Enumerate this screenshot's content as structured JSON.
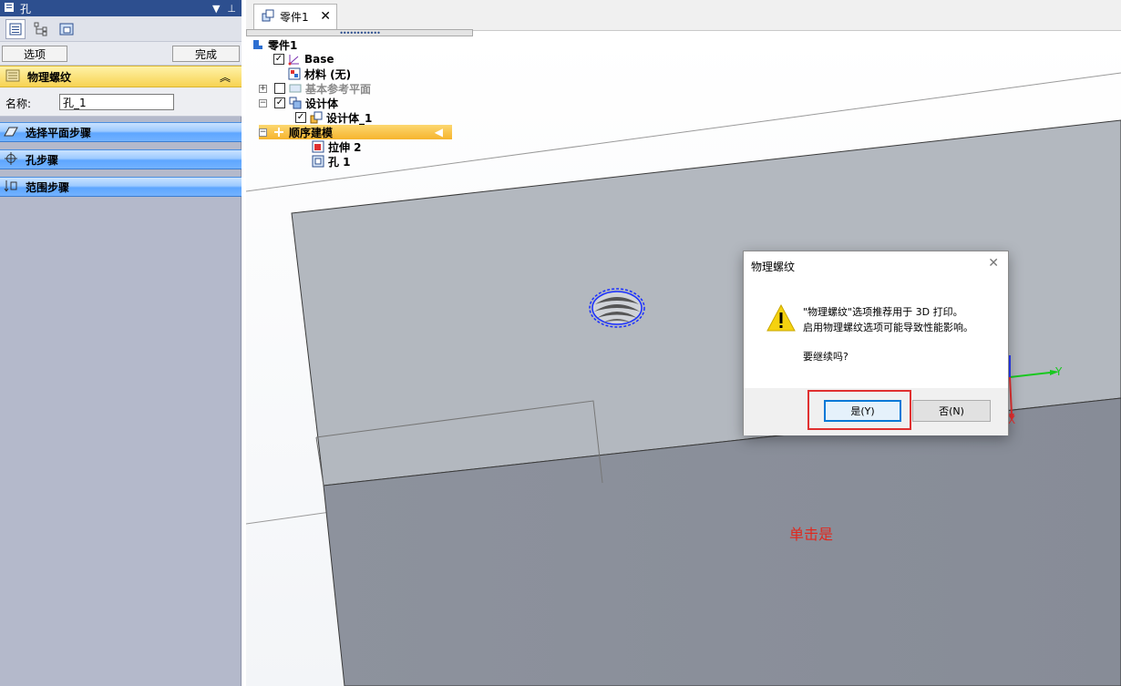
{
  "panel": {
    "title": "孔",
    "tabs": [
      "properties-icon",
      "tree-icon",
      "feature-icon"
    ],
    "options_button": "选项",
    "finish_button": "完成",
    "section_title": "物理螺纹",
    "name_label": "名称:",
    "name_value": "孔_1",
    "steps": [
      "选择平面步骤",
      "孔步骤",
      "范围步骤"
    ]
  },
  "document_tab": {
    "label": "零件1"
  },
  "tree": {
    "root": "零件1",
    "base": "Base",
    "material": "材料 (无)",
    "ref_planes": "基本参考平面",
    "design_body": "设计体",
    "design_body_1": "设计体_1",
    "ordered_modeling": "顺序建模",
    "extrude": "拉伸 2",
    "hole": "孔 1"
  },
  "dialog": {
    "title": "物理螺纹",
    "message_line1": "\"物理螺纹\"选项推荐用于 3D 打印。",
    "message_line2": "启用物理螺纹选项可能导致性能影响。",
    "question": "要继续吗?",
    "yes_button": "是(Y)",
    "no_button": "否(N)"
  },
  "annotation": {
    "hint": "单击是"
  },
  "axes": {
    "y": "Y",
    "x": "X"
  },
  "colors": {
    "panel_title_bg": "#2d4f8f",
    "section_yellow": "#f7d352",
    "step_blue": "#5ea6ff",
    "face_top": "#b3b8bf",
    "face_front": "#8c919b",
    "highlight_red": "#e03030"
  }
}
